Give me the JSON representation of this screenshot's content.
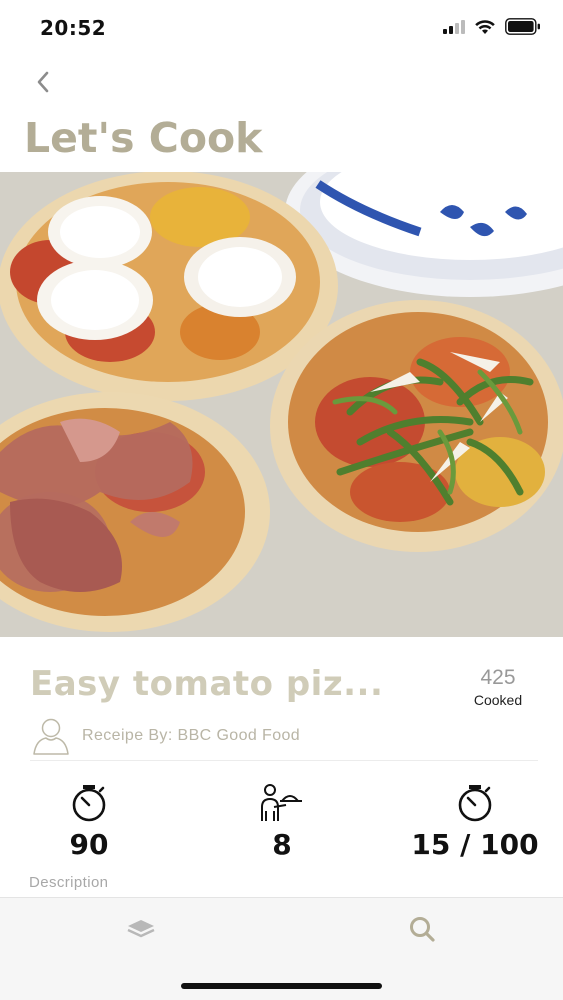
{
  "status_bar": {
    "time": "20:52",
    "icons": [
      "signal-icon",
      "wifi-icon",
      "battery-icon"
    ]
  },
  "nav": {
    "back_icon": "chevron-left-icon"
  },
  "page": {
    "title": "Let's Cook",
    "title_color": "#b3ad96"
  },
  "hero": {
    "image_subject": "pizza-photo"
  },
  "recipe": {
    "title": "Easy tomato piz...",
    "cooked_count": "425",
    "cooked_label": "Cooked",
    "author": "Receipe By: BBC Good Food"
  },
  "stats": [
    {
      "icon": "stopwatch-icon",
      "value": "90"
    },
    {
      "icon": "waiter-serving-icon",
      "value": "8"
    },
    {
      "icon": "stopwatch-icon",
      "value": "15 / 100"
    }
  ],
  "description": {
    "label": "Description"
  },
  "tab_bar": {
    "tabs": [
      {
        "icon": "layers-icon"
      },
      {
        "icon": "search-icon"
      }
    ],
    "accent": "#b3ad96"
  }
}
